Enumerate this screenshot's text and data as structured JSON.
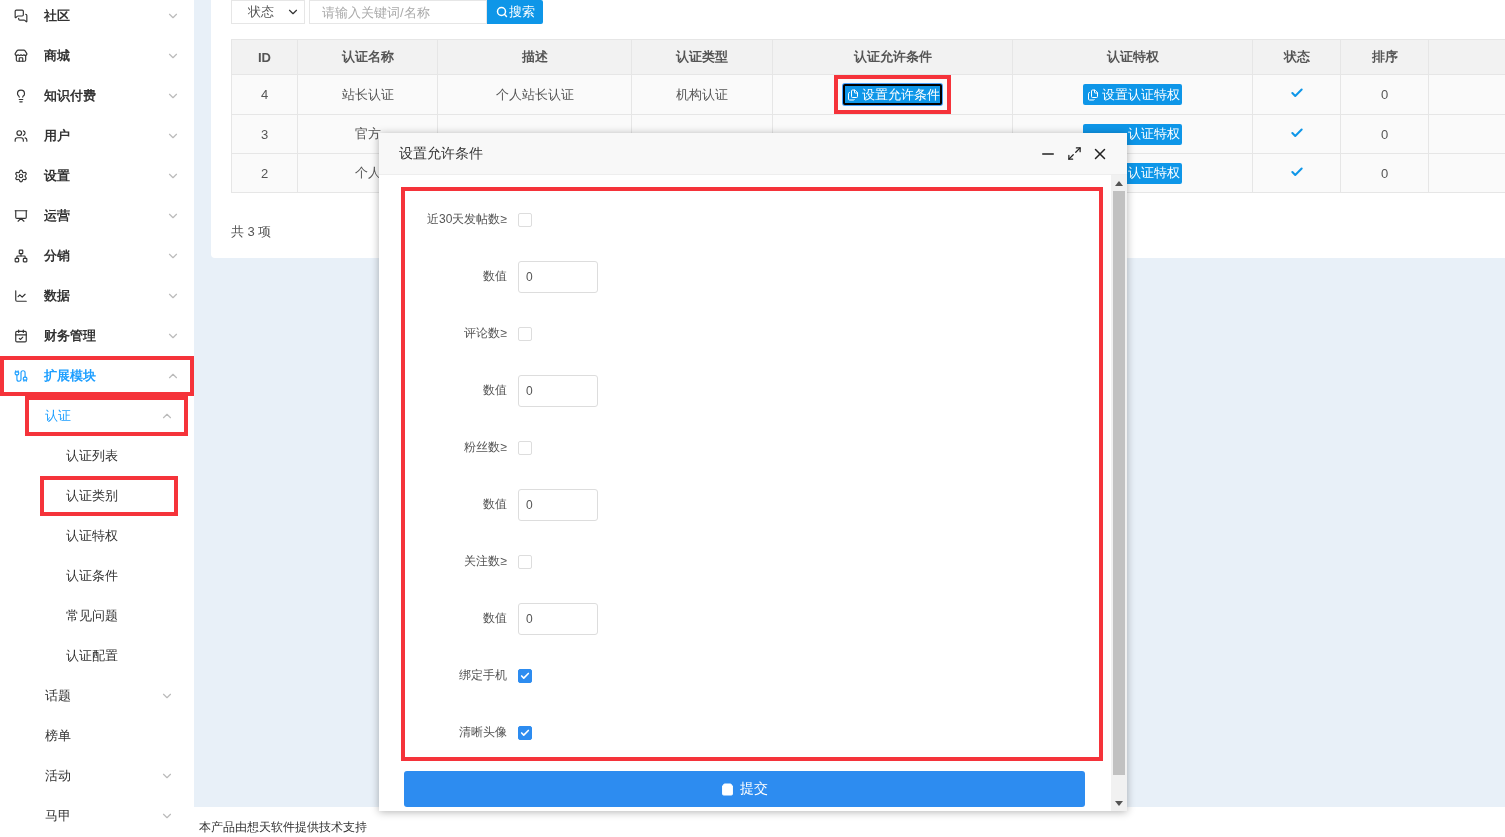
{
  "sidebar": {
    "items": [
      {
        "label": "社区",
        "expanded": false,
        "has_children": true
      },
      {
        "label": "商城",
        "expanded": false,
        "has_children": true
      },
      {
        "label": "知识付费",
        "expanded": false,
        "has_children": true
      },
      {
        "label": "用户",
        "expanded": false,
        "has_children": true
      },
      {
        "label": "设置",
        "expanded": false,
        "has_children": true
      },
      {
        "label": "运营",
        "expanded": false,
        "has_children": true
      },
      {
        "label": "分销",
        "expanded": false,
        "has_children": true
      },
      {
        "label": "数据",
        "expanded": false,
        "has_children": true
      },
      {
        "label": "财务管理",
        "expanded": false,
        "has_children": true
      },
      {
        "label": "扩展模块",
        "expanded": true,
        "has_children": true,
        "highlighted": true,
        "children": [
          {
            "label": "认证",
            "expanded": true,
            "has_children": true,
            "highlighted": true,
            "children": [
              {
                "label": "认证列表",
                "selected": false,
                "highlighted": false
              },
              {
                "label": "认证类别",
                "selected": false,
                "highlighted": true
              },
              {
                "label": "认证特权",
                "selected": false,
                "highlighted": false
              },
              {
                "label": "认证条件",
                "selected": false,
                "highlighted": false
              },
              {
                "label": "常见问题",
                "selected": false,
                "highlighted": false
              },
              {
                "label": "认证配置",
                "selected": false,
                "highlighted": false
              }
            ]
          },
          {
            "label": "话题",
            "expanded": false,
            "has_children": true,
            "highlighted": false
          },
          {
            "label": "榜单",
            "expanded": false,
            "has_children": false,
            "highlighted": false
          },
          {
            "label": "活动",
            "expanded": false,
            "has_children": true,
            "highlighted": false
          },
          {
            "label": "马甲",
            "expanded": false,
            "has_children": true,
            "highlighted": false
          }
        ]
      }
    ]
  },
  "toolbar": {
    "status_select": "状态",
    "search": {
      "placeholder": "请输入关键词/名称"
    },
    "search_button": "搜索"
  },
  "table": {
    "columns": [
      "ID",
      "认证名称",
      "描述",
      "认证类型",
      "认证允许条件",
      "认证特权",
      "状态",
      "排序"
    ],
    "rows": [
      {
        "id": "4",
        "name": "站长认证",
        "description": "个人站长认证",
        "type": "机构认证",
        "condition_button": {
          "label": "设置允许条件",
          "focused": true,
          "highlighted": true
        },
        "privilege_button": "设置认证特权",
        "status": true,
        "sort": "0"
      },
      {
        "id": "3",
        "name": "官方",
        "privilege_button": "认证特权",
        "status": true,
        "sort": "0"
      },
      {
        "id": "2",
        "name": "个人",
        "privilege_button": "认证特权",
        "status": true,
        "sort": "0"
      }
    ],
    "total": "共 3 项"
  },
  "footer": "本产品由想天软件提供技术支持",
  "dialog": {
    "title": "设置允许条件",
    "highlighted": true,
    "fields": [
      {
        "kind": "checkbox",
        "label": "近30天发帖数≥",
        "checked": false
      },
      {
        "kind": "number",
        "label": "数值",
        "value": "0"
      },
      {
        "kind": "checkbox",
        "label": "评论数≥",
        "checked": false
      },
      {
        "kind": "number",
        "label": "数值",
        "value": "0"
      },
      {
        "kind": "checkbox",
        "label": "粉丝数≥",
        "checked": false
      },
      {
        "kind": "number",
        "label": "数值",
        "value": "0"
      },
      {
        "kind": "checkbox",
        "label": "关注数≥",
        "checked": false
      },
      {
        "kind": "number",
        "label": "数值",
        "value": "0"
      },
      {
        "kind": "checkbox",
        "label": "绑定手机",
        "checked": true
      },
      {
        "kind": "checkbox",
        "label": "清晰头像",
        "checked": true
      }
    ],
    "submit": "提交"
  }
}
